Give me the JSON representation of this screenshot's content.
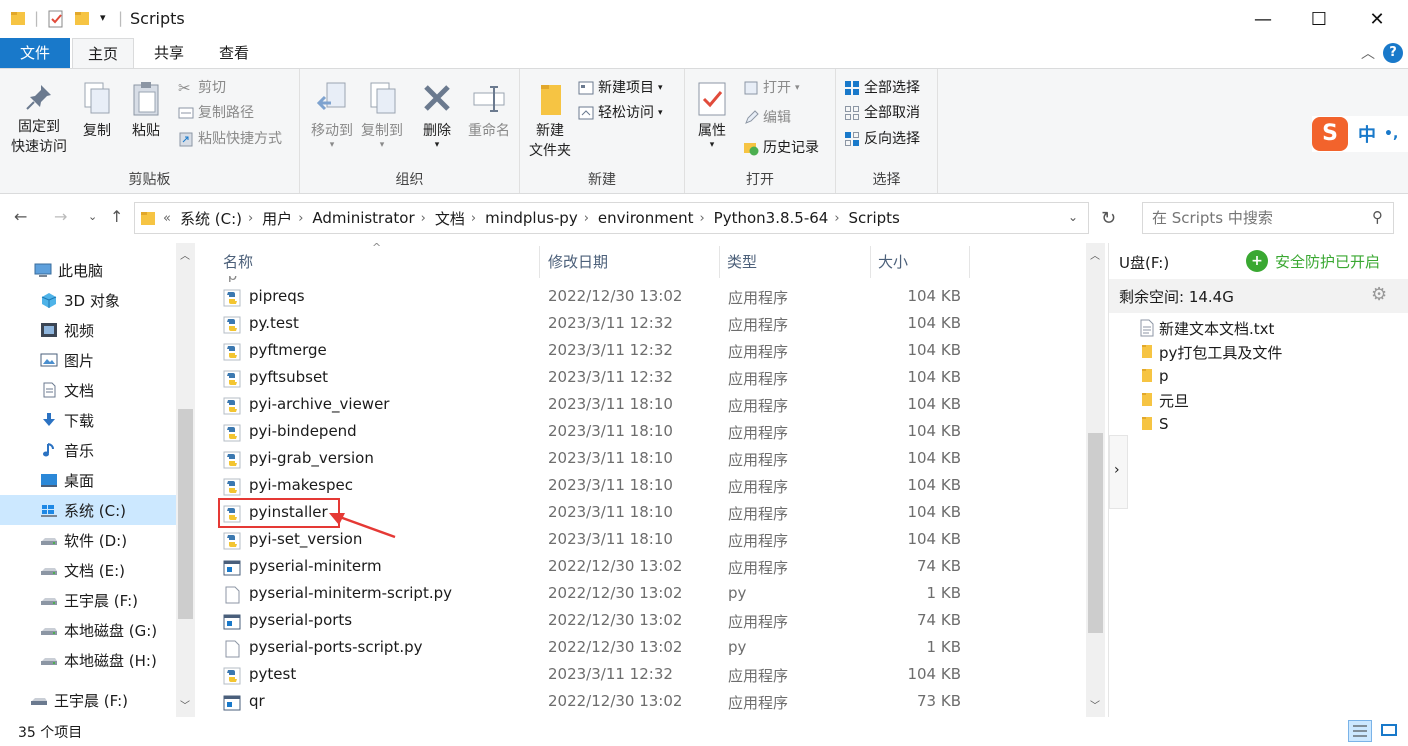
{
  "window": {
    "title": "Scripts",
    "minimize_glyph": "—",
    "maximize_glyph": "☐",
    "close_glyph": "✕"
  },
  "ribbon_tabs": [
    "文件",
    "主页",
    "共享",
    "查看"
  ],
  "ribbon": {
    "clipboard": {
      "label": "剪贴板",
      "pin": "固定到\n快速访问",
      "pin_line1": "固定到",
      "pin_line2": "快速访问",
      "copy": "复制",
      "paste": "粘贴",
      "cut": "剪切",
      "copy_path": "复制路径",
      "paste_shortcut": "粘贴快捷方式"
    },
    "organize": {
      "label": "组织",
      "move_to": "移动到",
      "copy_to": "复制到",
      "delete": "删除",
      "rename": "重命名"
    },
    "new": {
      "label": "新建",
      "new_folder_line1": "新建",
      "new_folder_line2": "文件夹",
      "new_item": "新建项目",
      "easy_access": "轻松访问"
    },
    "open": {
      "label": "打开",
      "properties": "属性",
      "open": "打开",
      "edit": "编辑",
      "history": "历史记录"
    },
    "select": {
      "label": "选择",
      "select_all": "全部选择",
      "select_none": "全部取消",
      "invert": "反向选择"
    }
  },
  "ime": {
    "label": "中",
    "extra": "•,"
  },
  "address": {
    "breadcrumbs": [
      "系统 (C:)",
      "用户",
      "Administrator",
      "文档",
      "mindplus-py",
      "environment",
      "Python3.8.5-64",
      "Scripts"
    ],
    "overflow": "«",
    "search_placeholder": "在 Scripts 中搜索"
  },
  "nav_pane": [
    {
      "label": "此电脑",
      "icon": "computer-icon",
      "indent": 0
    },
    {
      "label": "3D 对象",
      "icon": "3d-objects-icon",
      "indent": 1
    },
    {
      "label": "视频",
      "icon": "video-icon",
      "indent": 1
    },
    {
      "label": "图片",
      "icon": "pictures-icon",
      "indent": 1
    },
    {
      "label": "文档",
      "icon": "documents-icon",
      "indent": 1
    },
    {
      "label": "下载",
      "icon": "download-icon",
      "indent": 1
    },
    {
      "label": "音乐",
      "icon": "music-icon",
      "indent": 1
    },
    {
      "label": "桌面",
      "icon": "desktop-icon",
      "indent": 1
    },
    {
      "label": "系统 (C:)",
      "icon": "windows-drive-icon",
      "indent": 1,
      "selected": true
    },
    {
      "label": "软件 (D:)",
      "icon": "drive-icon",
      "indent": 1
    },
    {
      "label": "文档 (E:)",
      "icon": "drive-icon",
      "indent": 1
    },
    {
      "label": "王宇晨 (F:)",
      "icon": "drive-icon",
      "indent": 1
    },
    {
      "label": "本地磁盘 (G:)",
      "icon": "drive-icon",
      "indent": 1
    },
    {
      "label": "本地磁盘 (H:)",
      "icon": "drive-icon",
      "indent": 1
    },
    {
      "label": "王宇晨 (F:)",
      "icon": "usb-drive-icon",
      "indent": 0
    }
  ],
  "columns": {
    "name": "名称",
    "date": "修改日期",
    "type": "类型",
    "size": "大小"
  },
  "files": [
    {
      "name": "pipreqs",
      "date": "2022/12/30 13:02",
      "type": "应用程序",
      "size": "104 KB",
      "icon": "python-exe-icon"
    },
    {
      "name": "py.test",
      "date": "2023/3/11 12:32",
      "type": "应用程序",
      "size": "104 KB",
      "icon": "python-exe-icon"
    },
    {
      "name": "pyftmerge",
      "date": "2023/3/11 12:32",
      "type": "应用程序",
      "size": "104 KB",
      "icon": "python-exe-icon"
    },
    {
      "name": "pyftsubset",
      "date": "2023/3/11 12:32",
      "type": "应用程序",
      "size": "104 KB",
      "icon": "python-exe-icon"
    },
    {
      "name": "pyi-archive_viewer",
      "date": "2023/3/11 18:10",
      "type": "应用程序",
      "size": "104 KB",
      "icon": "python-exe-icon"
    },
    {
      "name": "pyi-bindepend",
      "date": "2023/3/11 18:10",
      "type": "应用程序",
      "size": "104 KB",
      "icon": "python-exe-icon"
    },
    {
      "name": "pyi-grab_version",
      "date": "2023/3/11 18:10",
      "type": "应用程序",
      "size": "104 KB",
      "icon": "python-exe-icon"
    },
    {
      "name": "pyi-makespec",
      "date": "2023/3/11 18:10",
      "type": "应用程序",
      "size": "104 KB",
      "icon": "python-exe-icon"
    },
    {
      "name": "pyinstaller",
      "date": "2023/3/11 18:10",
      "type": "应用程序",
      "size": "104 KB",
      "icon": "python-exe-icon",
      "highlighted": true
    },
    {
      "name": "pyi-set_version",
      "date": "2023/3/11 18:10",
      "type": "应用程序",
      "size": "104 KB",
      "icon": "python-exe-icon"
    },
    {
      "name": "pyserial-miniterm",
      "date": "2022/12/30 13:02",
      "type": "应用程序",
      "size": "74 KB",
      "icon": "window-exe-icon"
    },
    {
      "name": "pyserial-miniterm-script.py",
      "date": "2022/12/30 13:02",
      "type": "py",
      "size": "1 KB",
      "icon": "blank-file-icon"
    },
    {
      "name": "pyserial-ports",
      "date": "2022/12/30 13:02",
      "type": "应用程序",
      "size": "74 KB",
      "icon": "window-exe-icon"
    },
    {
      "name": "pyserial-ports-script.py",
      "date": "2022/12/30 13:02",
      "type": "py",
      "size": "1 KB",
      "icon": "blank-file-icon"
    },
    {
      "name": "pytest",
      "date": "2023/3/11 12:32",
      "type": "应用程序",
      "size": "104 KB",
      "icon": "python-exe-icon"
    },
    {
      "name": "qr",
      "date": "2022/12/30 13:02",
      "type": "应用程序",
      "size": "73 KB",
      "icon": "window-exe-icon"
    }
  ],
  "preview": {
    "drive": "U盘(F:)",
    "security": "安全防护已开启",
    "free_space": "剩余空间: 14.4G",
    "items": [
      {
        "name": "新建文本文档.txt",
        "icon": "text-file-icon"
      },
      {
        "name": "py打包工具及文件",
        "icon": "folder-icon"
      },
      {
        "name": "p",
        "icon": "folder-icon"
      },
      {
        "name": "元旦",
        "icon": "folder-icon"
      },
      {
        "name": "S",
        "icon": "folder-icon"
      }
    ]
  },
  "status": {
    "count": "35 个项目"
  },
  "colors": {
    "accent": "#1979ca",
    "selection": "#cce8ff",
    "highlight_box": "#e53935",
    "security_green": "#3aa832"
  }
}
